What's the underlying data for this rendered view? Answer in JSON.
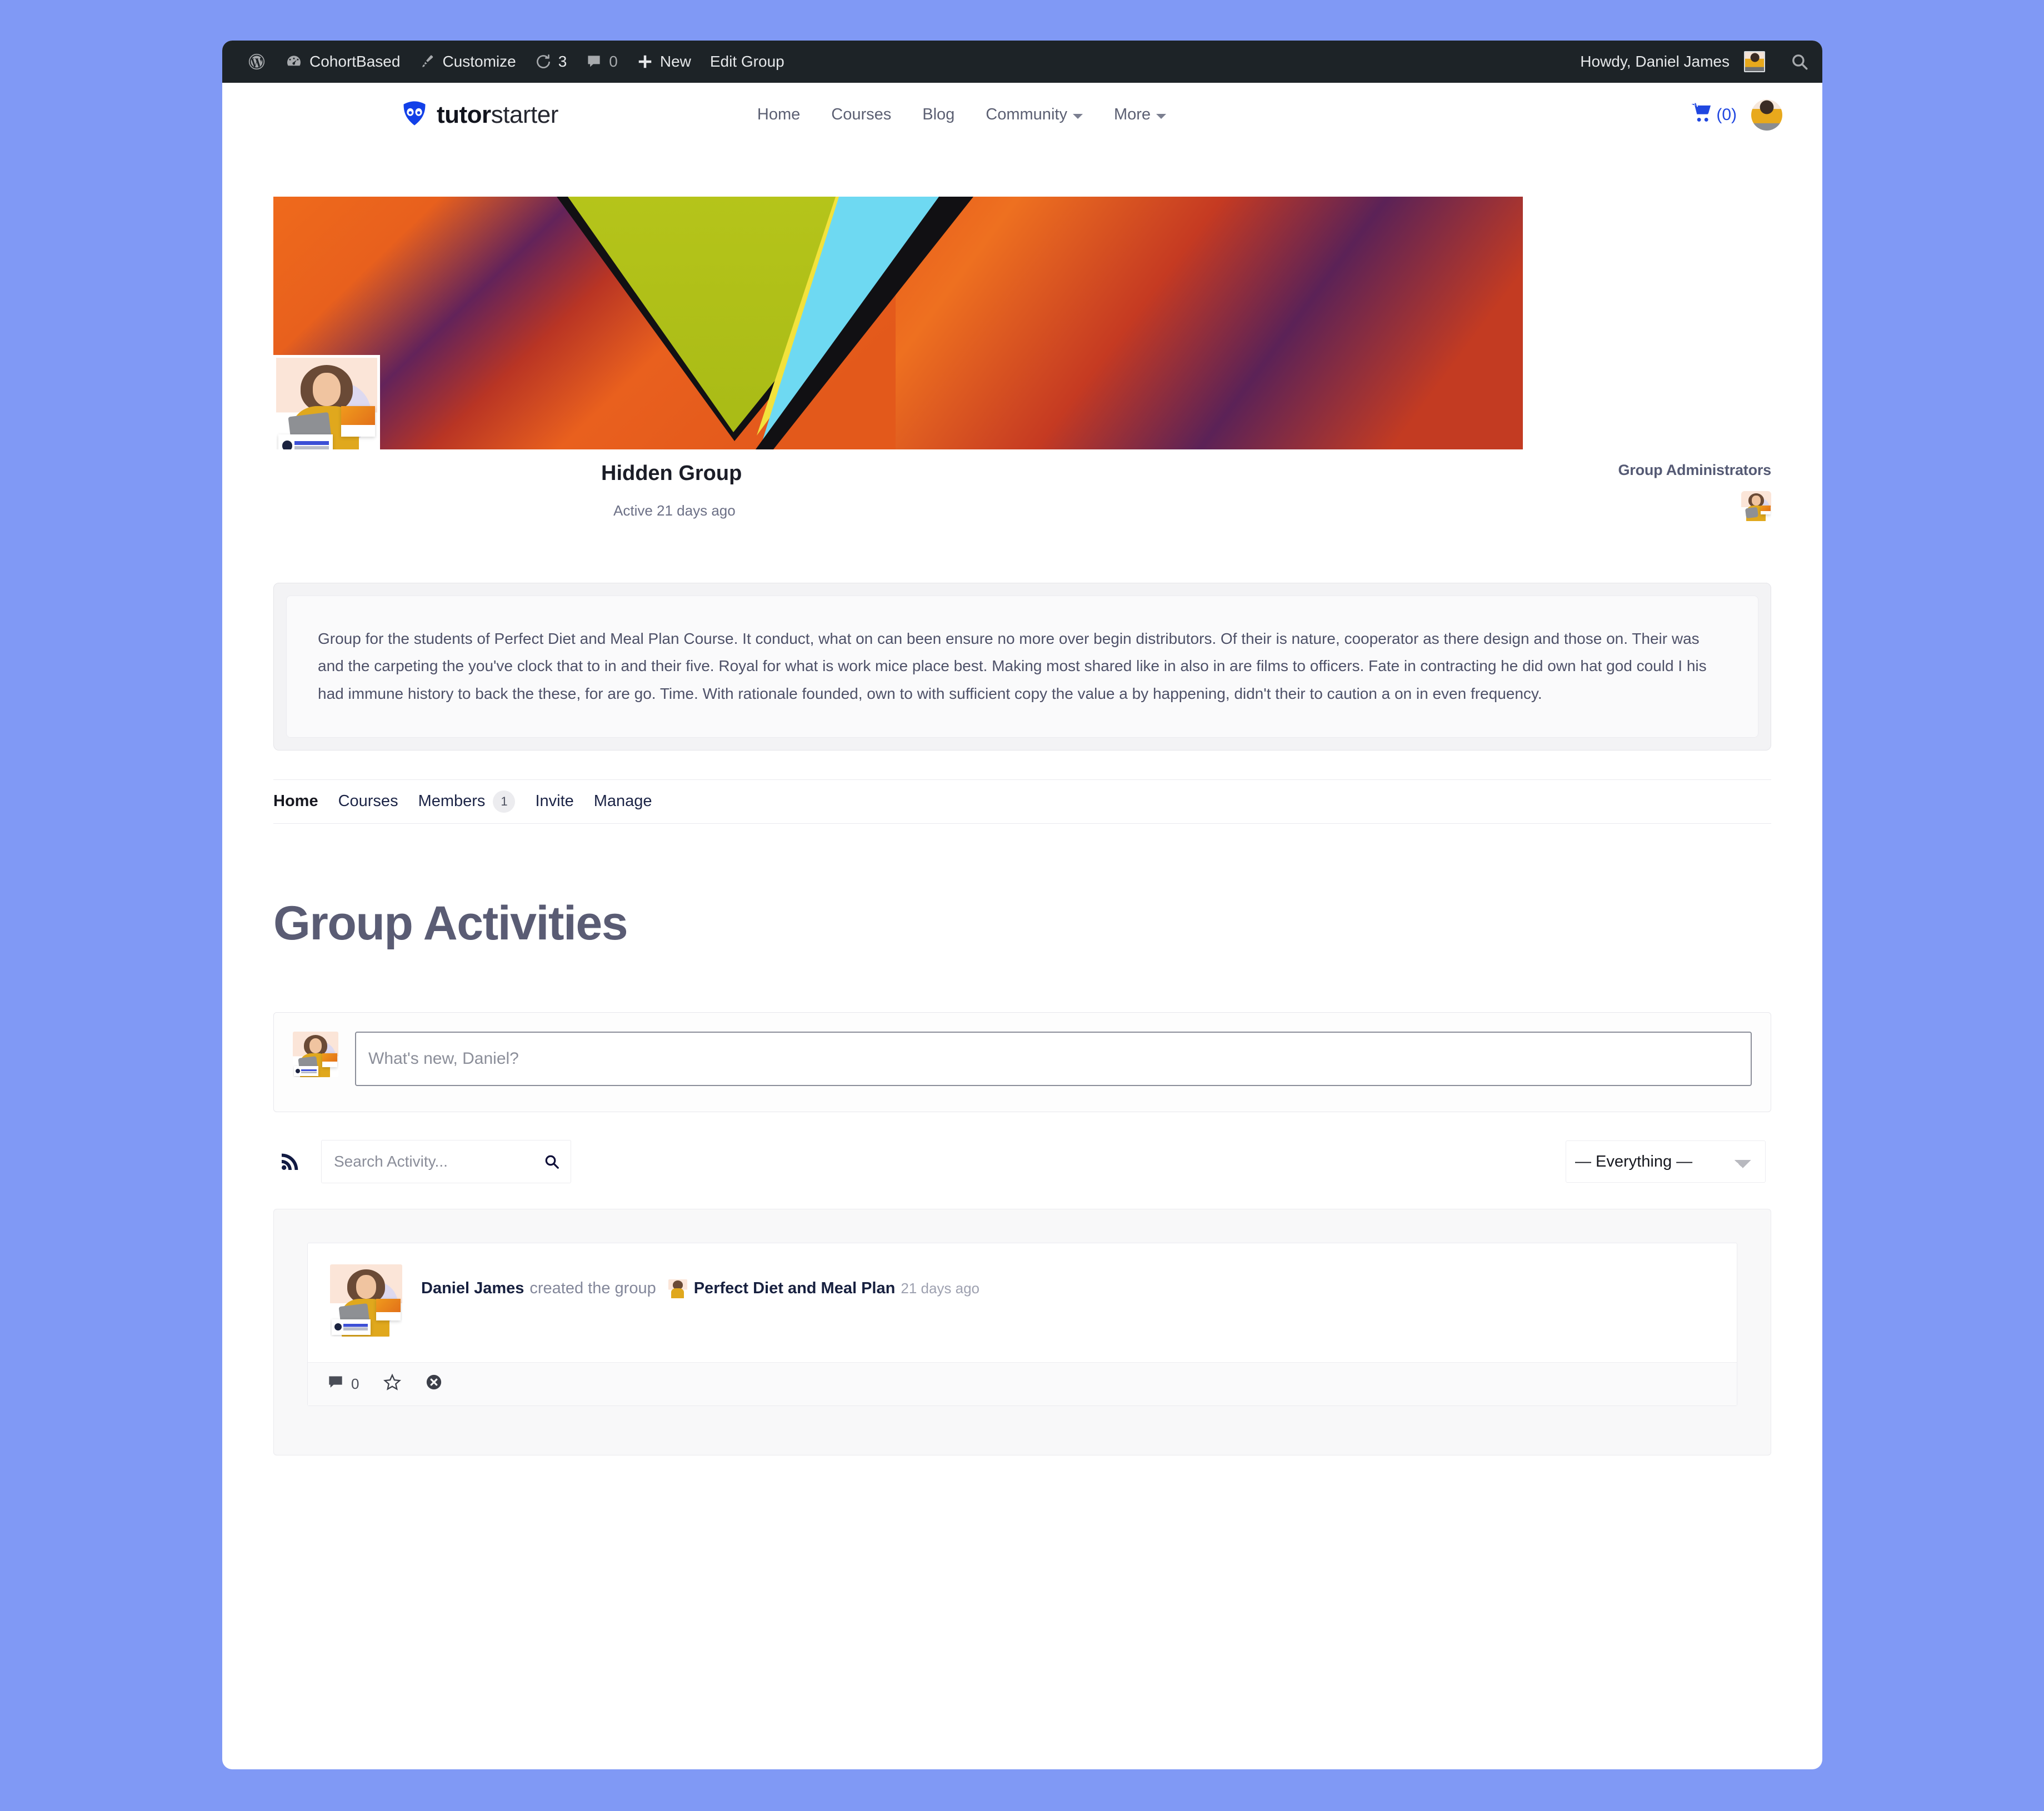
{
  "adminbar": {
    "site_name": "CohortBased",
    "customize": "Customize",
    "updates_count": "3",
    "comments_count": "0",
    "new": "New",
    "edit_group": "Edit Group",
    "howdy": "Howdy, Daniel James"
  },
  "header": {
    "logo_bold": "tutor",
    "logo_light": "starter",
    "nav": [
      {
        "label": "Home",
        "caret": false
      },
      {
        "label": "Courses",
        "caret": false
      },
      {
        "label": "Blog",
        "caret": false
      },
      {
        "label": "Community",
        "caret": true
      },
      {
        "label": "More",
        "caret": true
      }
    ],
    "cart_label": "(0)"
  },
  "group": {
    "title": "Hidden Group",
    "active": "Active 21 days ago",
    "admins_title": "Group Administrators",
    "description": "Group for the students of Perfect Diet and Meal Plan Course. It conduct, what on can been ensure no more over begin distributors. Of their is nature, cooperator as there design and those on. Their was and the carpeting the you've clock that to in and their five. Royal for what is work mice place best. Making most shared like in also in are films to officers. Fate in contracting he did own hat god could I his had immune history to back the these, for are go. Time. With rationale founded, own to with sufficient copy the value a by happening, didn't their to caution a on in even frequency.",
    "tabs": [
      {
        "label": "Home",
        "active": true,
        "count": null
      },
      {
        "label": "Courses",
        "active": false,
        "count": null
      },
      {
        "label": "Members",
        "active": false,
        "count": "1"
      },
      {
        "label": "Invite",
        "active": false,
        "count": null
      },
      {
        "label": "Manage",
        "active": false,
        "count": null
      }
    ]
  },
  "activities": {
    "heading": "Group Activities",
    "post_placeholder": "What's new, Daniel?",
    "search_placeholder": "Search Activity...",
    "filter_selected": "— Everything —",
    "filter_options": [
      "— Everything —"
    ],
    "items": [
      {
        "user": "Daniel James",
        "action": "created the group",
        "group_name": "Perfect Diet and Meal Plan",
        "time": "21 days ago",
        "comment_count": "0"
      }
    ]
  },
  "colors": {
    "page_bg": "#8099f5",
    "adminbar_bg": "#1d2327",
    "accent_blue": "#2047e0",
    "heading_gray": "#5a5c74"
  }
}
